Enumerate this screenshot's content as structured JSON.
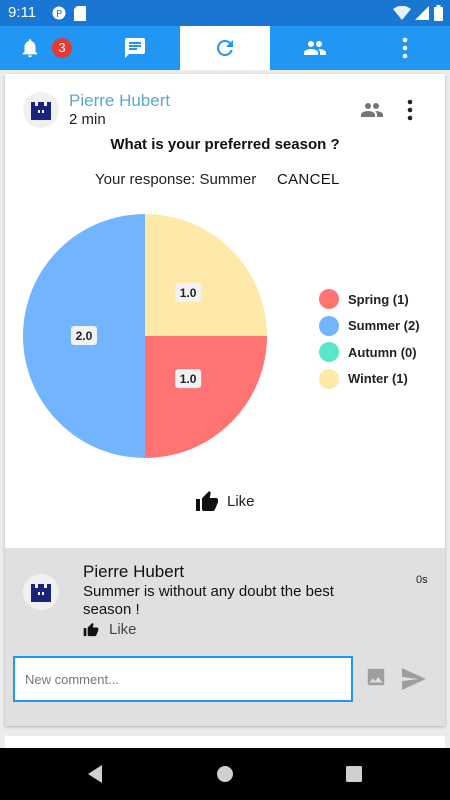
{
  "status_bar": {
    "time": "9:11"
  },
  "tabs": {
    "notifications_badge": "3",
    "active_tab": "refresh"
  },
  "post": {
    "author": "Pierre Hubert",
    "time_ago": "2 min",
    "question": "What is your preferred season ?",
    "response_label": "Your response: Summer",
    "cancel_label": "CANCEL",
    "like_label": "Like"
  },
  "chart_data": {
    "type": "pie",
    "title": "",
    "start_angle_deg": 0,
    "slices": [
      {
        "label": "Spring (1)",
        "value": 1,
        "data_label": "1.0",
        "color": "#ff7373"
      },
      {
        "label": "Summer (2)",
        "value": 2,
        "data_label": "2.0",
        "color": "#73b4ff"
      },
      {
        "label": "Autumn (0)",
        "value": 0,
        "data_label": "",
        "color": "#5be6c8"
      },
      {
        "label": "Winter (1)",
        "value": 1,
        "data_label": "1.0",
        "color": "#ffe9a8"
      }
    ],
    "legend_position": "right"
  },
  "comment": {
    "author": "Pierre Hubert",
    "text": "Summer is without any doubt the best season !",
    "time": "0s",
    "like_label": "Like"
  },
  "new_comment": {
    "placeholder": "New comment...",
    "value": ""
  },
  "colors": {
    "primary": "#2196f3",
    "status_bar": "#1976d2",
    "badge": "#e53935",
    "author_link": "#5aa7d6"
  }
}
